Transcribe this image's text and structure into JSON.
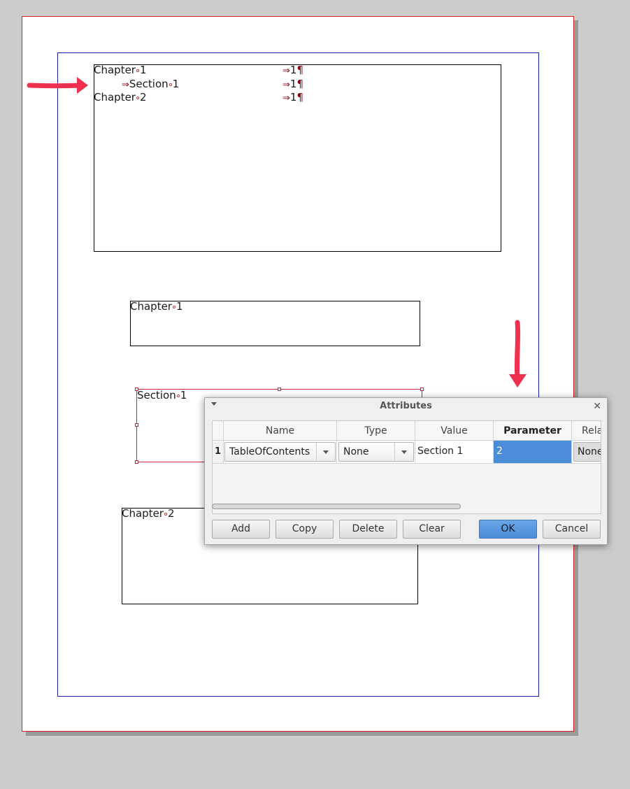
{
  "document": {
    "toc": [
      {
        "text_a": "Chapter",
        "text_b": "1",
        "page": "1",
        "indent": false
      },
      {
        "text_a": "Section",
        "text_b": "1",
        "page": "1",
        "indent": true
      },
      {
        "text_a": "Chapter",
        "text_b": "2",
        "page": "1",
        "indent": false
      }
    ],
    "tab_arrow": "⇒",
    "pilcrow": "¶",
    "frames": {
      "chapter1": {
        "a": "Chapter",
        "b": "1"
      },
      "section1": {
        "a": "Section",
        "b": "1"
      },
      "chapter2": {
        "a": "Chapter",
        "b": "2"
      }
    }
  },
  "dialog": {
    "title": "Attributes",
    "columns": [
      "Name",
      "Type",
      "Value",
      "Parameter",
      "Rela"
    ],
    "row": {
      "number": "1",
      "name": "TableOfContents",
      "type": "None",
      "value": "Section 1",
      "parameter": "2",
      "relation": "None"
    },
    "buttons": {
      "add": "Add",
      "copy": "Copy",
      "delete": "Delete",
      "clear": "Clear",
      "ok": "OK",
      "cancel": "Cancel"
    }
  },
  "colors": {
    "annotation_arrow": "#f0304f",
    "selection_accent": "#4a8cd8",
    "page_border": "#d42020",
    "margin_border": "#1b1bb0"
  }
}
